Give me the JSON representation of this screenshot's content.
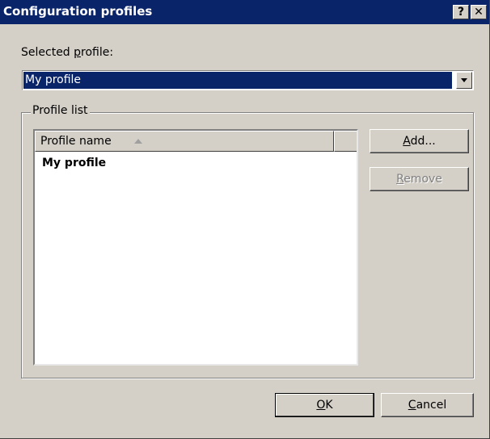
{
  "window": {
    "title": "Configuration profiles",
    "help_button": "?",
    "close_button": "✕"
  },
  "selected_profile": {
    "label_pre": "Selected ",
    "label_accel": "p",
    "label_post": "rofile:",
    "value": "My profile"
  },
  "profile_list": {
    "legend": "Profile list",
    "column_header": "Profile name",
    "items": [
      "My profile"
    ]
  },
  "buttons": {
    "add_accel": "A",
    "add_rest": "dd...",
    "remove_accel": "R",
    "remove_rest": "emove",
    "ok_accel": "O",
    "ok_rest": "K",
    "cancel_accel": "C",
    "cancel_rest": "ancel"
  },
  "colors": {
    "titlebar": "#0a246a",
    "face": "#d4d0c8",
    "selection": "#0a246a"
  }
}
